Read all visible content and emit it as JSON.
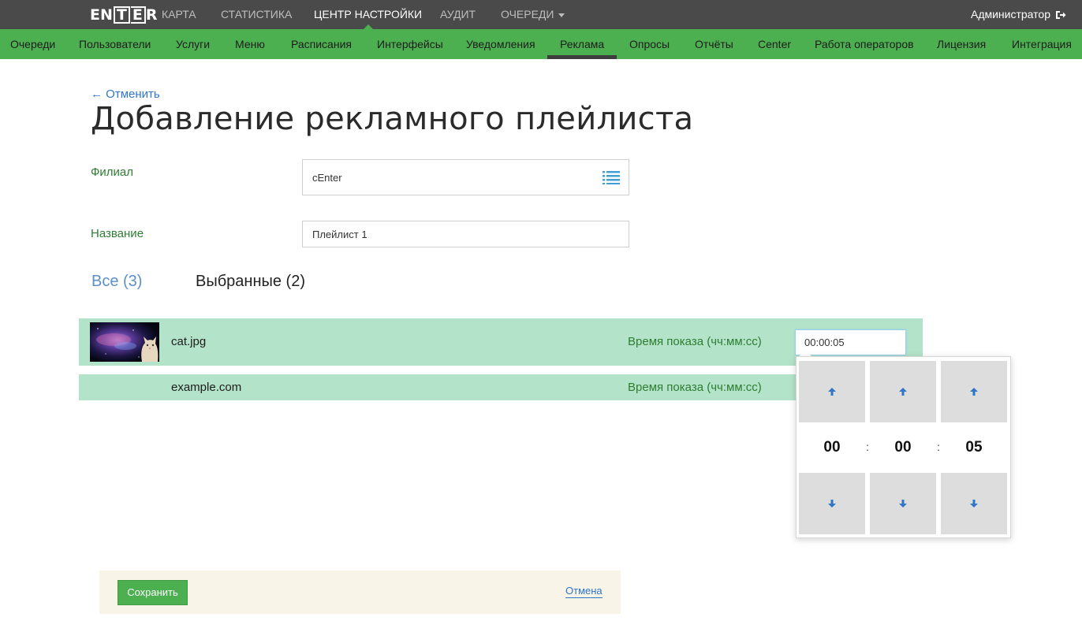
{
  "header": {
    "logo": "ENTER",
    "nav": [
      "КАРТА",
      "СТАТИСТИКА",
      "ЦЕНТР НАСТРОЙКИ",
      "АУДИТ",
      "ОЧЕРЕДИ"
    ],
    "active_nav": "ЦЕНТР НАСТРОЙКИ",
    "user": "Администратор"
  },
  "subnav": {
    "items": [
      "Очереди",
      "Пользователи",
      "Услуги",
      "Меню",
      "Расписания",
      "Интерфейсы",
      "Уведомления",
      "Реклама",
      "Опросы",
      "Отчёты",
      "Center",
      "Работа операторов",
      "Лицензия",
      "Интеграция"
    ],
    "active": "Реклама"
  },
  "page": {
    "back_label": "← Отменить",
    "title": "Добавление рекламного плейлиста"
  },
  "form": {
    "branch_label": "Филиал",
    "branch_value": "cEnter",
    "name_label": "Название",
    "name_value": "Плейлист 1"
  },
  "tabs": {
    "all": "Все (3)",
    "selected": "Выбранные (2)"
  },
  "items": [
    {
      "name": "cat.jpg",
      "time_label": "Время показа (чч:мм:сс)",
      "time_value": "00:00:05",
      "has_thumbnail": true
    },
    {
      "name": "example.com",
      "time_label": "Время показа (чч:мм:сс)",
      "has_thumbnail": false
    }
  ],
  "time_picker": {
    "hours": "00",
    "minutes": "00",
    "seconds": "05",
    "separator": ":"
  },
  "footer": {
    "save_label": "Сохранить",
    "cancel_label": "Отмена"
  },
  "colors": {
    "topbar": "#4a4a4a",
    "accent_green": "#4caf50",
    "row_green": "#b3e3c8",
    "link_blue": "#2f76c9",
    "label_green": "#2e7d32"
  }
}
